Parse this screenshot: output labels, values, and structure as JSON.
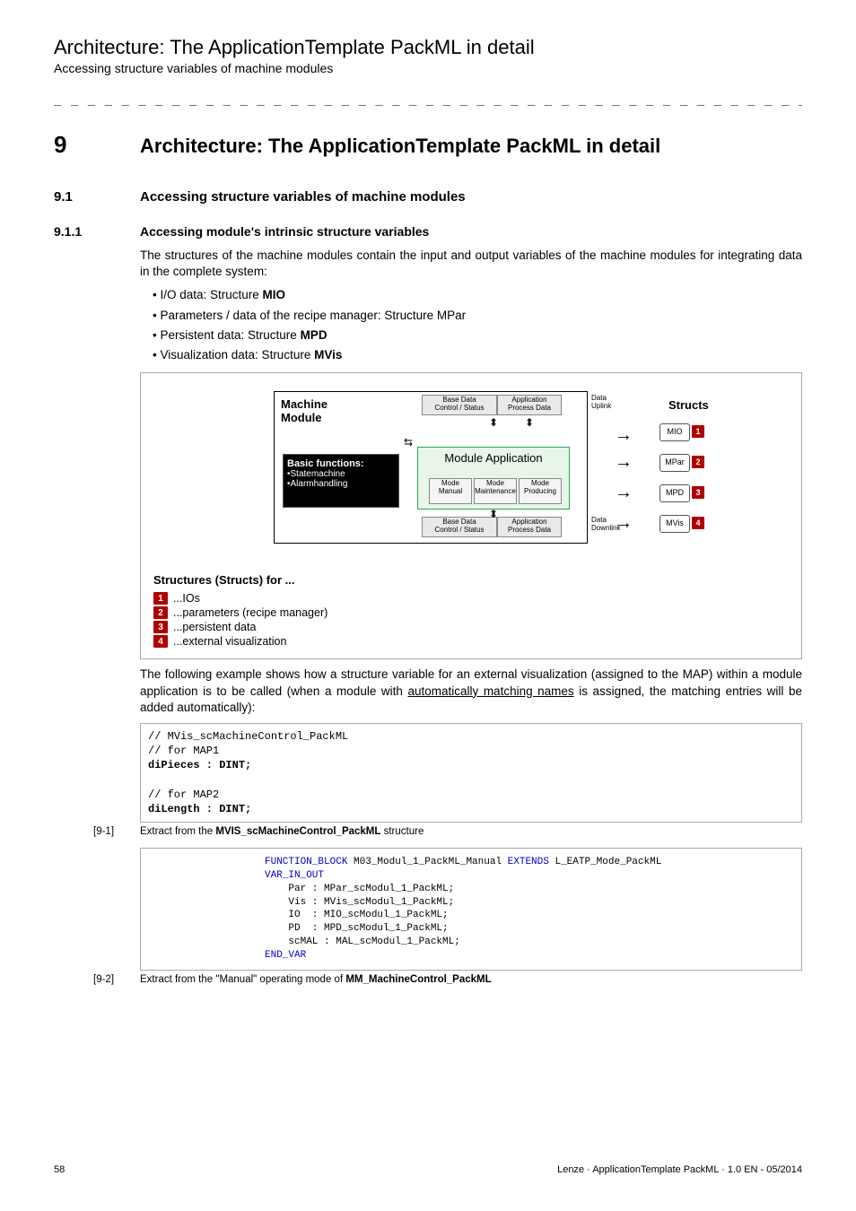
{
  "header": {
    "title": "Architecture: The ApplicationTemplate PackML in detail",
    "subtitle": "Accessing structure variables of machine modules",
    "dashes": "_ _ _ _ _ _ _ _ _ _ _ _ _ _ _ _ _ _ _ _ _ _ _ _ _ _ _ _ _ _ _ _ _ _ _ _ _ _ _ _ _ _ _ _ _ _ _ _ _ _ _ _ _ _ _ _ _ _ _ _ _ _ _ _"
  },
  "sec9": {
    "num": "9",
    "title": "Architecture: The ApplicationTemplate PackML in detail"
  },
  "sec91": {
    "num": "9.1",
    "title": "Accessing structure variables of machine modules"
  },
  "sec911": {
    "num": "9.1.1",
    "title": "Accessing module's intrinsic structure variables"
  },
  "intro": "The structures of the machine modules contain the input and output variables of the machine modules for integrating data in the complete system:",
  "bullets": {
    "b1a": "I/O data: Structure ",
    "b1b": "MIO",
    "b2": "Parameters / data of the recipe manager: Structure MPar",
    "b3a": "Persistent data: Structure ",
    "b3b": "MPD",
    "b4a": "Visualization data: Structure ",
    "b4b": "MVis"
  },
  "diagram": {
    "mm": "Machine\nModule",
    "bf_title": "Basic functions:",
    "bf_l1": "•Statemachine",
    "bf_l2": "•Alarmhandling",
    "app": "Module Application",
    "mode1": "Mode\nManual",
    "mode2": "Mode\nMaintenance",
    "mode3": "Mode\nProducing",
    "top1": "Base Data\nControl / Status",
    "top2": "Application\nProcess Data",
    "bot1": "Base Data\nControl / Status",
    "bot2": "Application\nProcess Data",
    "uplink": "Data\nUplink",
    "downlink": "Data\nDownlink",
    "structs": "Structs",
    "s1": "MIO",
    "s2": "MPar",
    "s3": "MPD",
    "s4": "MVis"
  },
  "structs_caption": "Structures (Structs) for ...",
  "legend": {
    "i1": "...IOs",
    "i2": "...parameters (recipe manager)",
    "i3": "...persistent data",
    "i4": "...external visualization"
  },
  "para2a": "The following example shows how a structure variable for an external visualization (assigned to the MAP) within a module application is to be called (when a module with ",
  "para2_link": "automatically matching names",
  "para2b": " is assigned, the matching entries will be added automatically):",
  "code1": {
    "l1": "// MVis_scMachineControl_PackML",
    "l2": "// for MAP1",
    "l3": "diPieces : DINT;",
    "l4": "",
    "l5": "// for MAP2",
    "l6": "diLength : DINT;"
  },
  "cap1": {
    "ref": "[9-1]",
    "pre": "Extract from the ",
    "bold": "MVIS_scMachineControl_PackML",
    "post": " structure"
  },
  "code2": {
    "l1a": "FUNCTION_BLOCK",
    "l1b": " M03_Modul_1_PackML_Manual ",
    "l1c": "EXTENDS",
    "l1d": " L_EATP_Mode_PackML",
    "l2": "VAR_IN_OUT",
    "l3": "    Par : MPar_scModul_1_PackML;",
    "l4": "    Vis : MVis_scModul_1_PackML;",
    "l5": "    IO  : MIO_scModul_1_PackML;",
    "l6": "    PD  : MPD_scModul_1_PackML;",
    "l7": "    scMAL : MAL_scModul_1_PackML;",
    "l8": "END_VAR"
  },
  "cap2": {
    "ref": "[9-2]",
    "pre": "Extract from the \"Manual\" operating mode of ",
    "bold": "MM_MachineControl_PackML"
  },
  "footer": {
    "page": "58",
    "right": "Lenze · ApplicationTemplate PackML · 1.0 EN - 05/2014"
  }
}
